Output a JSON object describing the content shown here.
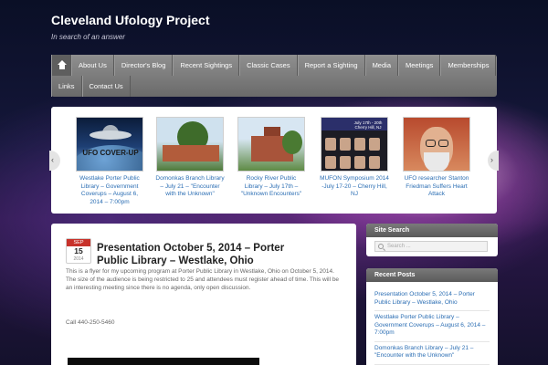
{
  "site": {
    "title": "Cleveland Ufology Project",
    "tagline": "In search of an answer"
  },
  "nav": {
    "home_icon": "home-icon",
    "items_row1": [
      "About Us",
      "Director's Blog",
      "Recent Sightings",
      "Classic Cases",
      "Report a Sighting",
      "Media",
      "Meetings",
      "Memberships"
    ],
    "items_row2": [
      "Links",
      "Contact Us"
    ]
  },
  "slider": {
    "slides": [
      {
        "caption": "Westlake Porter Public Library – Government Coverups – August 6, 2014 – 7:00pm",
        "image_text": "UFO COVER-UP"
      },
      {
        "caption": "Domonkas Branch Library – July 21 – \"Encounter with the Unknown\""
      },
      {
        "caption": "Rocky River Public Library – July 17th – \"Unknown Encounters\""
      },
      {
        "caption": "MUFON Symposium 2014 -July 17-20 – Cherry Hill, NJ",
        "image_text": "July 17th - 20th Cherry Hill, NJ"
      },
      {
        "caption": "UFO researcher Stanton Friedman Suffers Heart Attack"
      }
    ]
  },
  "post": {
    "month": "SEP",
    "day": "15",
    "year": "2014",
    "title": "Presentation October 5, 2014 – Porter Public Library – Westlake, Ohio",
    "body": "This is a flyer for my upcoming program at Porter Public Library in Westlake, Ohio on October 5, 2014. The size of the audience is being restricted to 25 and attendees must register ahead of time. This will be an interesting meeting since there is no agenda, only open discussion.",
    "phone": "Call 440-250-5460"
  },
  "sidebar": {
    "search": {
      "title": "Site Search",
      "placeholder": "Search ..."
    },
    "recent": {
      "title": "Recent Posts",
      "items": [
        "Presentation October 5, 2014 – Porter Public Library – Westlake, Ohio",
        "Westlake Porter Public Library – Government Coverups – August 6, 2014 – 7:00pm",
        "Domonkas Branch Library – July 21 – \"Encounter with the Unknown\""
      ]
    }
  },
  "colors": {
    "link": "#2a6db3",
    "date_badge": "#c8322b"
  }
}
